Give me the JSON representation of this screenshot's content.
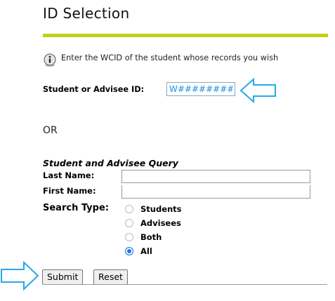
{
  "page": {
    "title": "ID Selection",
    "info_text": "Enter the WCID of the student whose records you wish"
  },
  "id_section": {
    "label": "Student or Advisee ID:",
    "value": "W########"
  },
  "or_text": "OR",
  "query": {
    "title": "Student and Advisee Query",
    "last_name_label": "Last Name:",
    "last_name_value": "",
    "first_name_label": "First Name:",
    "first_name_value": "",
    "search_type_label": "Search Type:",
    "options": [
      {
        "label": "Students",
        "checked": false
      },
      {
        "label": "Advisees",
        "checked": false
      },
      {
        "label": "Both",
        "checked": false
      },
      {
        "label": "All",
        "checked": true
      }
    ]
  },
  "buttons": {
    "submit": "Submit",
    "reset": "Reset"
  },
  "colors": {
    "accent_bar": "#c4cf18",
    "annotation_arrow": "#29a8e8",
    "radio_selected": "#1a73e8"
  },
  "icons": {
    "info": "info-icon",
    "annotation": "arrow-outline-icon"
  }
}
